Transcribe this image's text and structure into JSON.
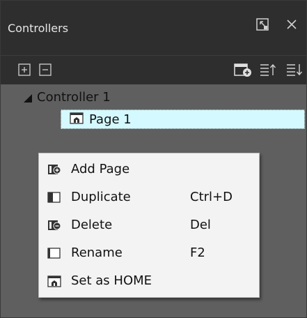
{
  "window": {
    "title": "Controllers"
  },
  "tree": {
    "controller": "Controller 1",
    "page": "Page 1"
  },
  "context_menu": {
    "items": [
      {
        "label": "Add Page",
        "shortcut": ""
      },
      {
        "label": "Duplicate",
        "shortcut": "Ctrl+D"
      },
      {
        "label": "Delete",
        "shortcut": "Del"
      },
      {
        "label": "Rename",
        "shortcut": "F2"
      },
      {
        "label": "Set as HOME",
        "shortcut": ""
      }
    ]
  },
  "colors": {
    "selection_bg": "#d4f9ff",
    "panel_bg": "#5f5f5f",
    "title_bg": "#2e2e2e"
  }
}
